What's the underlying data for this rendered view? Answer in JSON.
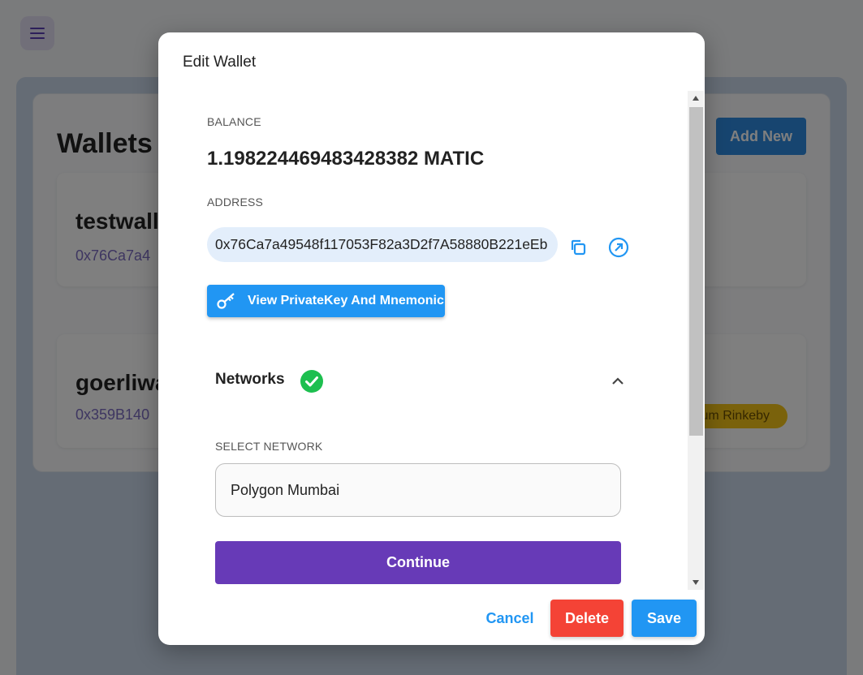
{
  "background": {
    "title": "Wallets",
    "add_new_label": "Add New",
    "wallets": [
      {
        "name": "testwall",
        "address": "0x76Ca7a4"
      },
      {
        "name": "goerliwa",
        "address": "0x359B140",
        "network_badge": "um Rinkeby"
      }
    ]
  },
  "dialog": {
    "title": "Edit Wallet",
    "balance_label": "BALANCE",
    "balance_value": "1.198224469483428382 MATIC",
    "address_label": "ADDRESS",
    "address_value": "0x76Ca7a49548f117053F82a3D2f7A58880B221eEb",
    "view_key_label": "View PrivateKey And Mnemonic",
    "networks_label": "Networks",
    "select_network_label": "SELECT NETWORK",
    "selected_network": "Polygon Mumbai",
    "continue_label": "Continue",
    "cancel_label": "Cancel",
    "delete_label": "Delete",
    "save_label": "Save"
  },
  "colors": {
    "primary": "#2196f3",
    "purple": "#673ab7",
    "danger": "#f44336",
    "success": "#1dbf4f"
  }
}
